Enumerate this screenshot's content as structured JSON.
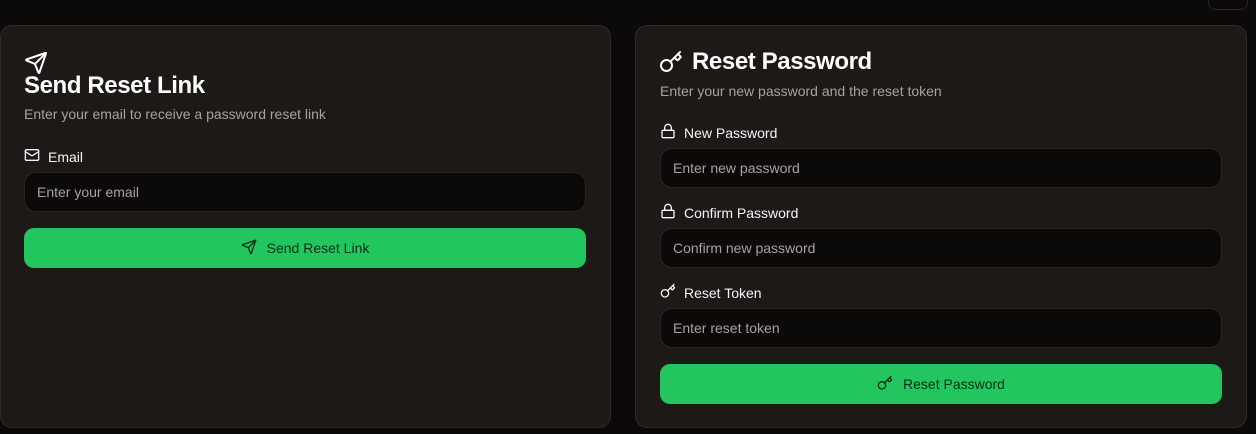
{
  "send_card": {
    "icon": "send-icon",
    "title": "Send Reset Link",
    "description": "Enter your email to receive a password reset link",
    "email_label": "Email",
    "email_icon": "mail-icon",
    "email_placeholder": "Enter your email",
    "button_label": "Send Reset Link",
    "button_icon": "send-icon"
  },
  "reset_card": {
    "icon": "key-icon",
    "title": "Reset Password",
    "description": "Enter your new password and the reset token",
    "new_password_label": "New Password",
    "new_password_placeholder": "Enter new password",
    "confirm_password_label": "Confirm Password",
    "confirm_password_placeholder": "Confirm new password",
    "token_label": "Reset Token",
    "token_placeholder": "Enter reset token",
    "button_label": "Reset Password",
    "button_icon": "key-icon"
  },
  "colors": {
    "background": "#0c0a09",
    "card": "#1c1917",
    "accent": "#22c55e"
  }
}
